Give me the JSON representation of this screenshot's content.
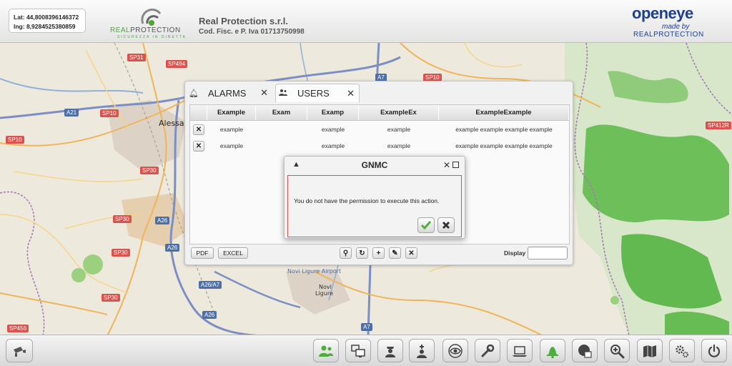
{
  "header": {
    "coords": {
      "lat": "Lat: 44,8008396146372",
      "lng": "lng: 8,9284525380859"
    },
    "logo": {
      "brand_a": "REAL",
      "brand_b": "PROTECTION",
      "tagline": "SICUREZZA IN DIRETTA"
    },
    "company": {
      "name": "Real Protection s.r.l.",
      "vat": "Cod. Fisc. e P. Iva 01713750998"
    },
    "openeye": {
      "title": "openeye",
      "made_by": "made by",
      "brand": "REALPROTECTION"
    }
  },
  "map": {
    "cities": [
      "Alessan",
      "Novi",
      "Ligure",
      "Novi Ligure Airport"
    ],
    "road_labels": [
      "SP31",
      "SP494",
      "SP10",
      "A21",
      "SP10",
      "SP30",
      "SP30",
      "SP30",
      "SP30",
      "A26",
      "A26",
      "A26/A7",
      "A26",
      "SP456",
      "A7",
      "SP412R",
      "A7",
      "SP10"
    ]
  },
  "panel": {
    "tabs": [
      {
        "label": "ALARMS",
        "icon": "bell-icon",
        "close": "✕"
      },
      {
        "label": "USERS",
        "icon": "users-icon",
        "close": "✕"
      }
    ],
    "columns": [
      "",
      "Example",
      "Exam",
      "Examp",
      "ExampleEx",
      "ExampleExample"
    ],
    "rows": [
      {
        "delete": "✕",
        "cells": [
          "example",
          "",
          "example",
          "example",
          "example example example example"
        ]
      },
      {
        "delete": "✕",
        "cells": [
          "example",
          "",
          "example",
          "example",
          "example example example example"
        ]
      }
    ],
    "footer": {
      "pdf": "PDF",
      "excel": "EXCEL",
      "search": "⚲",
      "refresh": "↻",
      "add": "+",
      "edit": "✎",
      "delete": "✕",
      "display_label": "Display",
      "display_value": ""
    }
  },
  "dialog": {
    "title": "GNMC",
    "warning": "▲",
    "close": "✕",
    "message": "You do not have the permission to execute this action."
  },
  "toolbar": {
    "buttons": [
      "camera-icon",
      "users-icon",
      "monitors-icon",
      "guard-icon",
      "medic-icon",
      "eye-icon",
      "wrench-icon",
      "laptop-icon",
      "bell-icon",
      "globe-icon",
      "zoom-in-icon",
      "map-icon",
      "gears-icon",
      "power-icon"
    ],
    "accent": "#4caf3a"
  }
}
